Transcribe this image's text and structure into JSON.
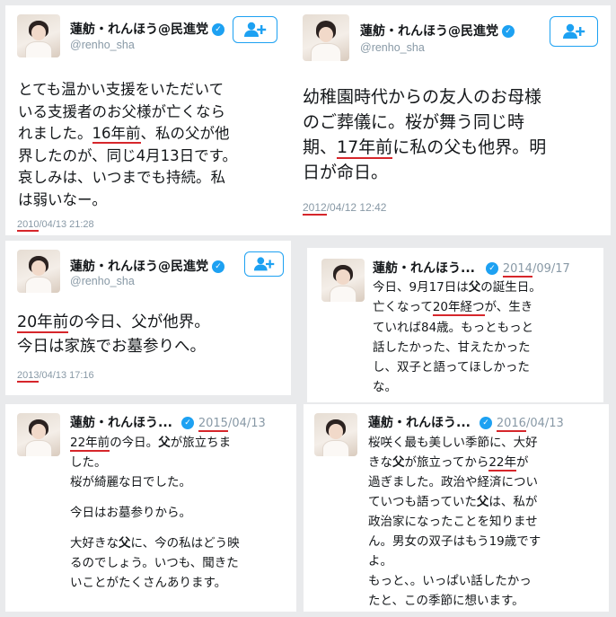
{
  "account": {
    "name": "蓮舫・れんほう@民進党",
    "handle": "@renho_sha",
    "name_short": "蓮舫・れんほう..."
  },
  "tweets": [
    {
      "lines": [
        "とても温かい支援をいただいて",
        "いる支援者のお父様が亡くなら",
        "れました。",
        "16年前",
        "、私の父が他",
        "界したのが、同じ4月13日です。",
        "哀しみは、いつまでも持続。私",
        "は弱いなー。"
      ],
      "date_year": "2010",
      "date_rest": "/04/13 21:28"
    },
    {
      "lines": [
        "幼稚園時代からの友人のお母様",
        "のご葬儀に。桜が舞う同じ時",
        "期、",
        "17年前",
        "に私の父も他界。明",
        "日が命日。"
      ],
      "date_year": "2012",
      "date_rest": "/04/12 12:42"
    },
    {
      "lines": [
        "20年前",
        "の今日、父が他界。",
        "今日は家族でお墓参りへ。"
      ],
      "date_year": "2013",
      "date_rest": "/04/13 17:16"
    },
    {
      "date_year": "2014",
      "date_rest": "/09/17",
      "lines": [
        "今日、9月17日は",
        "父",
        "の誕生日。",
        "亡くなって",
        "20年経つ",
        "が、生き",
        "ていれば84歳。もっともっと",
        "話したかった、甘えたかった",
        "し、双子と語ってほしかった",
        "な。"
      ]
    },
    {
      "date_year": "2015",
      "date_rest": "/04/13",
      "lines": [
        "22年前",
        "の今日。",
        "父",
        "が旅立ちま",
        "した。",
        "桜が綺麗な日でした。",
        "今日はお墓参りから。",
        "大好きな",
        "父",
        "に、今の私はどう映",
        "るのでしょう。いつも、聞きた",
        "いことがたくさんあります。"
      ]
    },
    {
      "date_year": "2016",
      "date_rest": "/04/13",
      "lines": [
        "桜咲く最も美しい季節に、大好",
        "きな",
        "父",
        "が旅立ってから",
        "22年",
        "が",
        "過ぎました。政治や経済につい",
        "ていつも語っていた",
        "父",
        "は、私が",
        "政治家になったことを知りませ",
        "ん。男女の双子はもう19歳です",
        "よ。",
        "もっと、。いっぱい話したかっ",
        "たと、この季節に想います。"
      ]
    }
  ],
  "icons": {
    "verified": "verified-badge-icon",
    "follow": "follow-user-plus-icon"
  },
  "colors": {
    "accent": "#1da1f2",
    "underline": "#d6262b",
    "muted": "#8899a6"
  }
}
